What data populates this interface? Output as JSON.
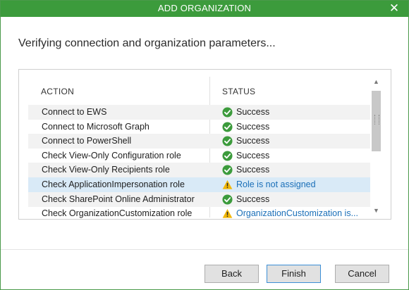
{
  "window": {
    "title": "ADD ORGANIZATION",
    "close_glyph": "✕"
  },
  "heading": "Verifying connection and organization parameters...",
  "table": {
    "columns": {
      "action": "ACTION",
      "status": "STATUS"
    },
    "rows": [
      {
        "action": "Connect to EWS",
        "status": "Success",
        "state": "success"
      },
      {
        "action": "Connect to Microsoft Graph",
        "status": "Success",
        "state": "success"
      },
      {
        "action": "Connect to PowerShell",
        "status": "Success",
        "state": "success"
      },
      {
        "action": "Check View-Only Configuration role",
        "status": "Success",
        "state": "success"
      },
      {
        "action": "Check View-Only Recipients role",
        "status": "Success",
        "state": "success"
      },
      {
        "action": "Check ApplicationImpersonation role",
        "status": "Role is not assigned",
        "state": "warning"
      },
      {
        "action": "Check SharePoint Online Administrator",
        "status": "Success",
        "state": "success"
      },
      {
        "action": "Check OrganizationCustomization role",
        "status": "OrganizationCustomization is...",
        "state": "warning"
      }
    ],
    "selected_row_index": 5,
    "icons": {
      "success": "check-circle-icon",
      "warning": "warning-triangle-icon"
    }
  },
  "buttons": {
    "back": "Back",
    "finish": "Finish",
    "cancel": "Cancel"
  },
  "colors": {
    "titlebar": "#3c9b3c",
    "success": "#3c9b3c",
    "warning": "#f2b705",
    "link": "#1a6fb8",
    "selected_row": "#d9eaf7"
  }
}
